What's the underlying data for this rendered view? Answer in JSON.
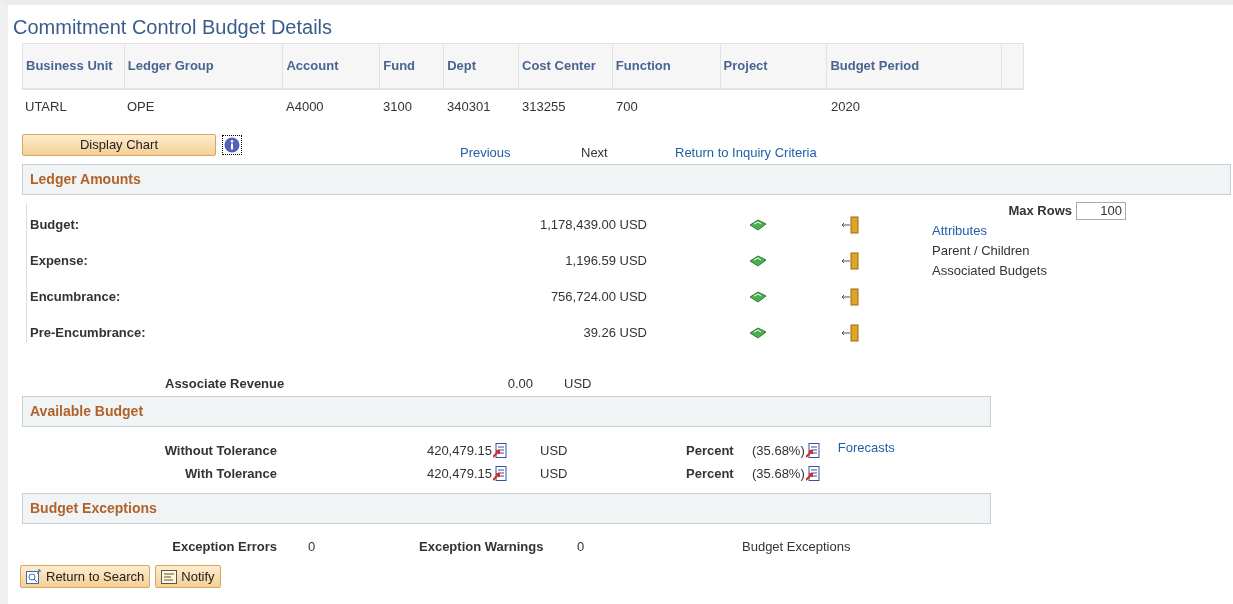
{
  "title": "Commitment Control Budget Details",
  "key_table": {
    "columns": [
      {
        "label": "Business Unit",
        "value": "UTARL"
      },
      {
        "label": "Ledger Group",
        "value": "OPE"
      },
      {
        "label": "Account",
        "value": "A4000"
      },
      {
        "label": "Fund",
        "value": "3100"
      },
      {
        "label": "Dept",
        "value": "340301"
      },
      {
        "label": "Cost Center",
        "value": "313255"
      },
      {
        "label": "Function",
        "value": "700"
      },
      {
        "label": "Project"
      },
      {
        "label": "Budget Period",
        "value": "2020"
      }
    ]
  },
  "display_chart_button": "Display Chart",
  "nav_links": [
    {
      "label": "Previous",
      "kind": "link"
    },
    {
      "label": "Next",
      "kind": "text"
    },
    {
      "label": "Return to Inquiry Criteria",
      "kind": "link"
    }
  ],
  "ledger_amounts": {
    "title": "Ledger Amounts",
    "rows": [
      {
        "label": "Budget:",
        "amount": "1,178,439.00 USD"
      },
      {
        "label": "Expense:",
        "amount": "1,196.59 USD"
      },
      {
        "label": "Encumbrance:",
        "amount": "756,724.00 USD"
      },
      {
        "label": "Pre-Encumbrance:",
        "amount": "39.26 USD"
      }
    ],
    "max_rows_label": "Max Rows",
    "max_rows_value": "100",
    "side_links": [
      {
        "label": "Attributes",
        "kind": "link"
      },
      {
        "label": "Parent / Children",
        "kind": "text"
      },
      {
        "label": "Associated Budgets",
        "kind": "text"
      }
    ]
  },
  "associate_revenue": {
    "label": "Associate Revenue",
    "amount": "0.00",
    "currency": "USD"
  },
  "available_budget": {
    "title": "Available Budget",
    "rows": [
      {
        "label": "Without Tolerance",
        "amount": "420,479.15",
        "currency": "USD",
        "percent_label": "Percent",
        "percent": "(35.68%)",
        "link": "Forecasts"
      },
      {
        "label": "With Tolerance",
        "amount": "420,479.15",
        "currency": "USD",
        "percent_label": "Percent",
        "percent": "(35.68%)"
      }
    ]
  },
  "budget_exceptions": {
    "title": "Budget Exceptions",
    "errors_label": "Exception Errors",
    "errors": "0",
    "warnings_label": "Exception Warnings",
    "warnings": "0",
    "link": "Budget Exceptions"
  },
  "footer_buttons": [
    {
      "label": "Return to Search",
      "kind": "search"
    },
    {
      "label": "Notify",
      "kind": "notify"
    }
  ]
}
